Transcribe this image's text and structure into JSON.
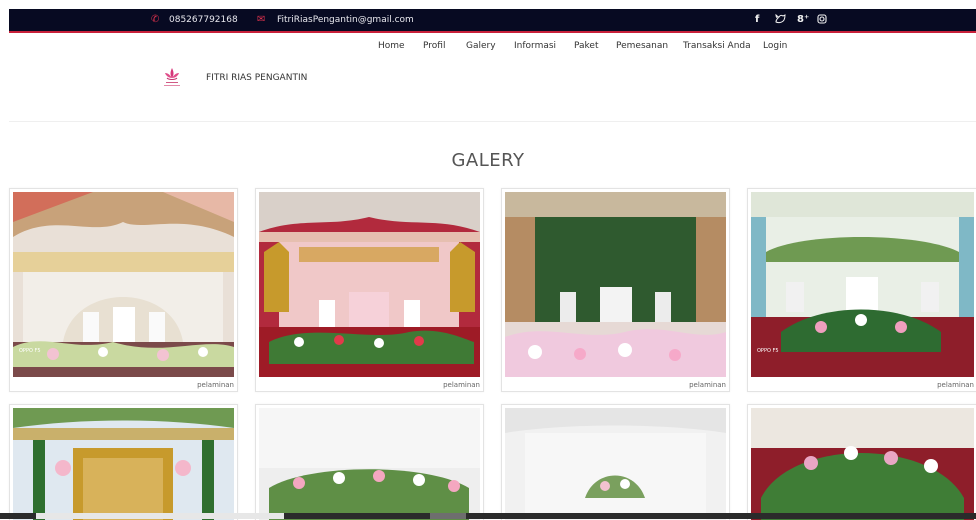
{
  "contact": {
    "phone": "085267792168",
    "email": "FitriRiasPengantin@gmail.com",
    "phone_icon": "phone-icon",
    "email_icon": "mail-icon"
  },
  "social": [
    "f",
    "✓",
    "8⁺",
    "◎"
  ],
  "nav": [
    "Home",
    "Profil",
    "Galery",
    "Informasi",
    "Paket",
    "Pemesanan",
    "Transaksi Anda",
    "Login"
  ],
  "brand": {
    "name": "FITRI RIAS PENGANTIN"
  },
  "page": {
    "title": "GALERY"
  },
  "gallery": [
    {
      "caption": "pelaminan"
    },
    {
      "caption": "pelaminan"
    },
    {
      "caption": "pelaminan"
    },
    {
      "caption": "pelaminan"
    },
    {
      "caption": ""
    },
    {
      "caption": ""
    },
    {
      "caption": ""
    },
    {
      "caption": ""
    }
  ],
  "colors": {
    "topbar": "#070a22",
    "accent": "#c8203a"
  }
}
